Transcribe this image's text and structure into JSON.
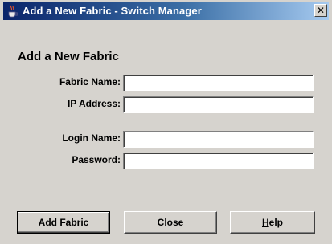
{
  "window": {
    "title": "Add a New Fabric - Switch Manager",
    "close_glyph": "✕",
    "icon": "java-coffee-cup-icon"
  },
  "form": {
    "heading": "Add a New Fabric",
    "fabric_name_label": "Fabric Name:",
    "fabric_name_value": "",
    "ip_address_label": "IP Address:",
    "ip_address_value": "",
    "login_name_label": "Login Name:",
    "login_name_value": "",
    "password_label": "Password:",
    "password_value": ""
  },
  "buttons": {
    "add_fabric": "Add Fabric",
    "close": "Close",
    "help_mnemonic": "H",
    "help_rest": "elp"
  },
  "colors": {
    "titlebar_start": "#0a246a",
    "titlebar_end": "#a6caf0",
    "dialog_bg": "#d6d3ce"
  }
}
